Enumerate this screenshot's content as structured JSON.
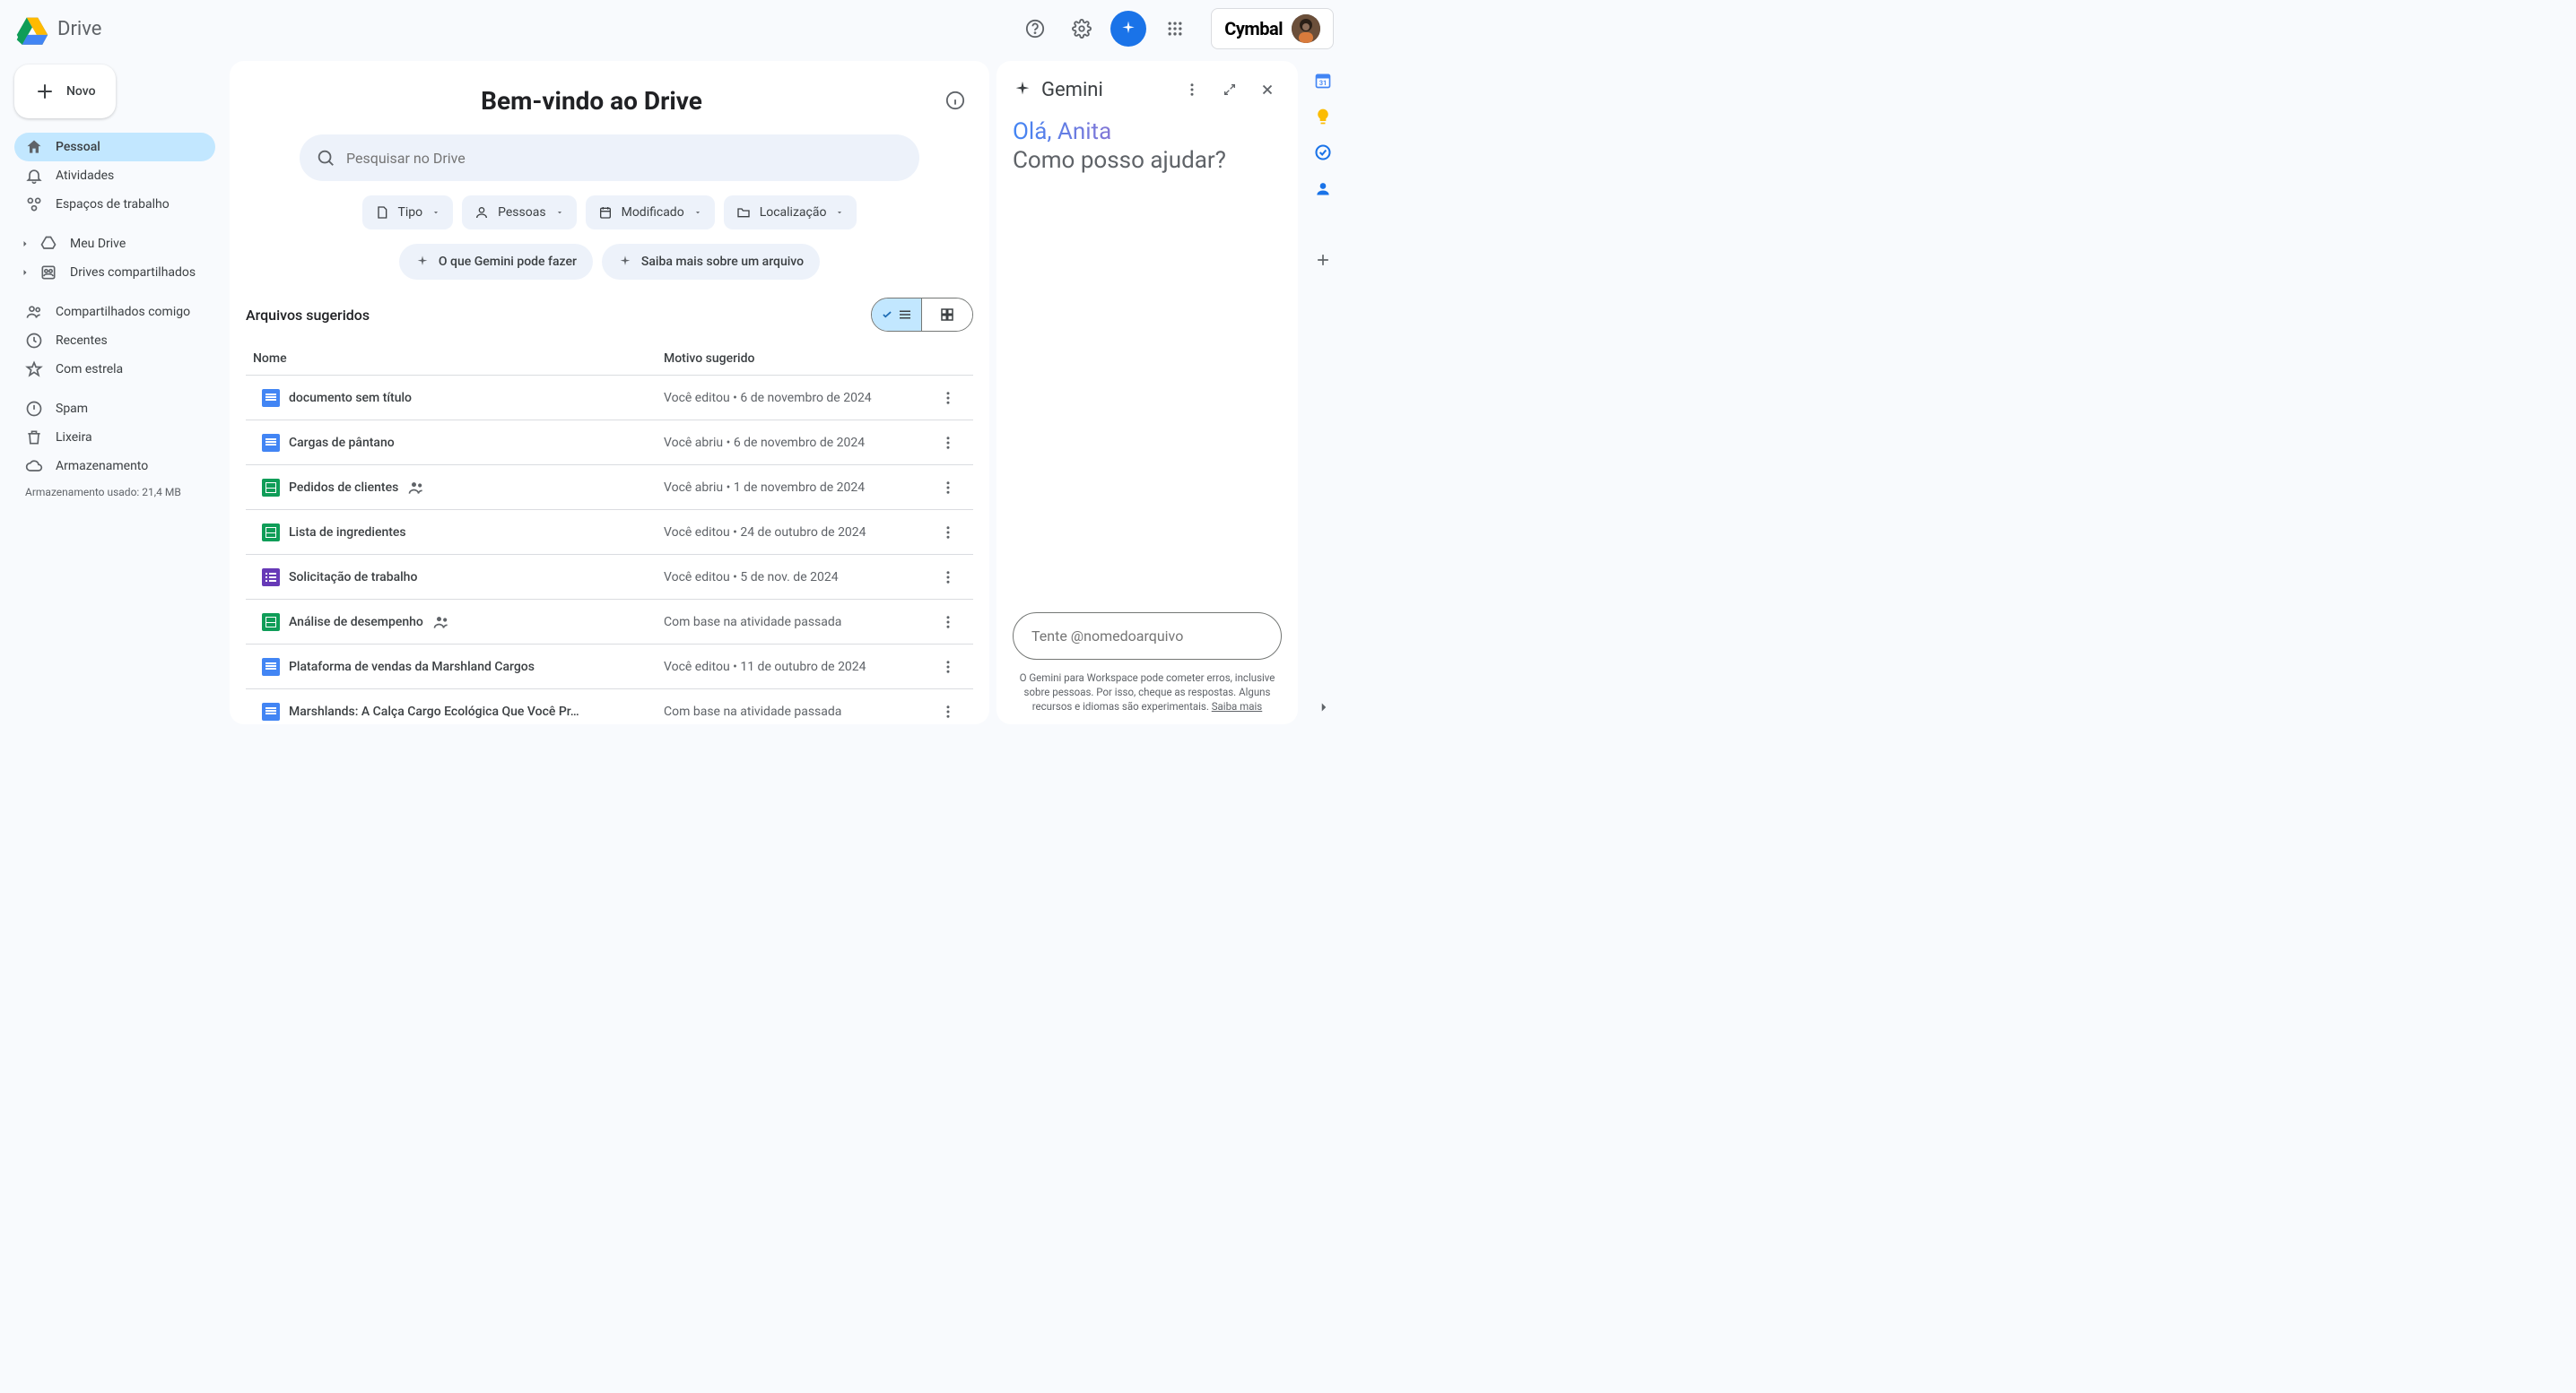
{
  "header": {
    "product": "Drive",
    "brand": "Cymbal"
  },
  "sidebar": {
    "new_label": "Novo",
    "items": [
      {
        "label": "Pessoal",
        "icon": "home"
      },
      {
        "label": "Atividades",
        "icon": "bell"
      },
      {
        "label": "Espaços de trabalho",
        "icon": "workspaces"
      }
    ],
    "drive_items": [
      {
        "label": "Meu Drive",
        "icon": "drive"
      },
      {
        "label": "Drives compartilhados",
        "icon": "shared-drive"
      }
    ],
    "other_items": [
      {
        "label": "Compartilhados comigo",
        "icon": "people"
      },
      {
        "label": "Recentes",
        "icon": "clock"
      },
      {
        "label": "Com estrela",
        "icon": "star"
      }
    ],
    "util_items": [
      {
        "label": "Spam",
        "icon": "spam"
      },
      {
        "label": "Lixeira",
        "icon": "trash"
      },
      {
        "label": "Armazenamento",
        "icon": "cloud"
      }
    ],
    "storage_text": "Armazenamento usado: 21,4 MB"
  },
  "main": {
    "welcome": "Bem-vindo ao Drive",
    "search_placeholder": "Pesquisar no Drive",
    "filters": [
      {
        "label": "Tipo",
        "icon": "file"
      },
      {
        "label": "Pessoas",
        "icon": "person"
      },
      {
        "label": "Modificado",
        "icon": "calendar"
      },
      {
        "label": "Localização",
        "icon": "folder"
      }
    ],
    "gemini_chips": [
      {
        "label": "O que Gemini pode fazer"
      },
      {
        "label": "Saiba mais sobre um arquivo"
      }
    ],
    "section_title": "Arquivos sugeridos",
    "col_name": "Nome",
    "col_reason": "Motivo sugerido",
    "files": [
      {
        "icon": "doc",
        "name": "documento sem título",
        "reason": "Você editou • 6 de novembro de 2024",
        "shared": false
      },
      {
        "icon": "doc",
        "name": "Cargas de pântano",
        "reason": "Você abriu • 6 de novembro de 2024",
        "shared": false
      },
      {
        "icon": "sheet",
        "name": "Pedidos de clientes",
        "reason": "Você abriu • 1 de novembro de 2024",
        "shared": true
      },
      {
        "icon": "sheet",
        "name": "Lista de ingredientes",
        "reason": "Você editou • 24 de outubro de 2024",
        "shared": false
      },
      {
        "icon": "form",
        "name": "Solicitação de trabalho",
        "reason": "Você editou • 5 de nov. de 2024",
        "shared": false
      },
      {
        "icon": "sheet",
        "name": "Análise de desempenho",
        "reason": "Com base na atividade passada",
        "shared": true
      },
      {
        "icon": "doc",
        "name": "Plataforma de vendas da Marshland Cargos",
        "reason": "Você editou • 11 de outubro de 2024",
        "shared": false
      },
      {
        "icon": "doc",
        "name": "Marshlands: A Calça Cargo Ecológica Que Você Pr…",
        "reason": "Com base na atividade passada",
        "shared": false
      }
    ]
  },
  "gemini": {
    "title": "Gemini",
    "greet": "Olá, Anita",
    "sub": "Como posso ajudar?",
    "placeholder": "Tente @nomedoarquivo",
    "disclaimer": "O Gemini para Workspace pode cometer erros, inclusive sobre pessoas. Por isso, cheque as respostas. Alguns recursos e idiomas são experimentais. ",
    "learn_more": "Saiba mais"
  }
}
